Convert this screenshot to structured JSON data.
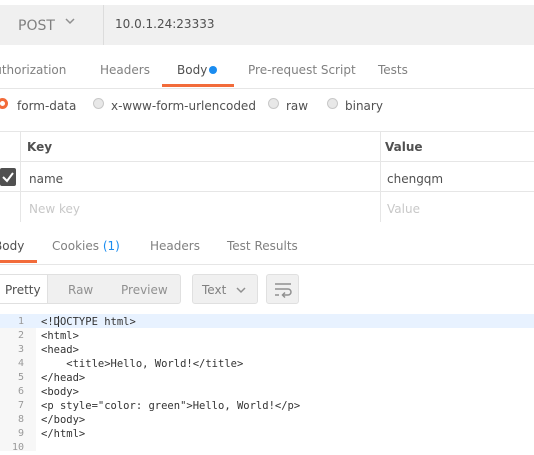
{
  "request": {
    "method": "POST",
    "url": "10.0.1.24:23333"
  },
  "request_tabs": {
    "authorization": "Authorization",
    "headers": "Headers",
    "body": "Body",
    "prerequest": "Pre-request Script",
    "tests": "Tests",
    "active": "Body"
  },
  "body_types": {
    "form_data": "form-data",
    "urlencoded": "x-www-form-urlencoded",
    "raw": "raw",
    "binary": "binary",
    "selected": "form-data"
  },
  "kv_table": {
    "headers": {
      "key": "Key",
      "value": "Value"
    },
    "rows": [
      {
        "checked": true,
        "key": "name",
        "value": "chengqm"
      }
    ],
    "placeholder": {
      "key": "New key",
      "value": "Value"
    }
  },
  "response_tabs": {
    "body": "Body",
    "cookies": "Cookies",
    "cookies_count": "(1)",
    "headers": "Headers",
    "tests": "Test Results",
    "active": "Body"
  },
  "view": {
    "pretty": "Pretty",
    "raw": "Raw",
    "preview": "Preview",
    "selected": "Pretty",
    "format": "Text"
  },
  "code": {
    "line_numbers": [
      "1",
      "2",
      "3",
      "4",
      "5",
      "6",
      "7",
      "8",
      "9",
      "10"
    ],
    "lines": [
      "<!DOCTYPE html>",
      "<html>",
      "<head>",
      "    <title>Hello, World!</title>",
      "</head>",
      "<body>",
      "<p style=\"color: green\">Hello, World!</p>",
      "</body>",
      "</html>",
      ""
    ]
  },
  "colors": {
    "accent": "#f26b3a",
    "link": "#1a8cf0"
  }
}
